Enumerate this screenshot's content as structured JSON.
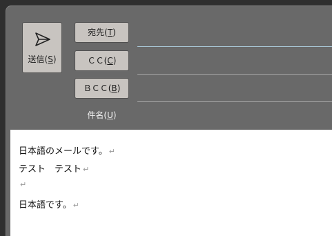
{
  "compose": {
    "send": {
      "label": "送信(",
      "key": "S",
      "close": ")"
    },
    "to": {
      "label": "宛先(",
      "key": "T",
      "close": ")"
    },
    "cc": {
      "label": "ＣＣ(",
      "key": "C",
      "close": ")"
    },
    "bcc": {
      "label": "ＢＣＣ(",
      "key": "B",
      "close": ")"
    },
    "subject": {
      "label": "件名(",
      "key": "U",
      "close": ")"
    }
  },
  "body": {
    "lines": [
      "日本語のメールです。",
      "テスト　テスト",
      "",
      "日本語です。"
    ],
    "paragraph_mark": "↵"
  },
  "icons": {
    "send": "send-arrow-icon"
  }
}
